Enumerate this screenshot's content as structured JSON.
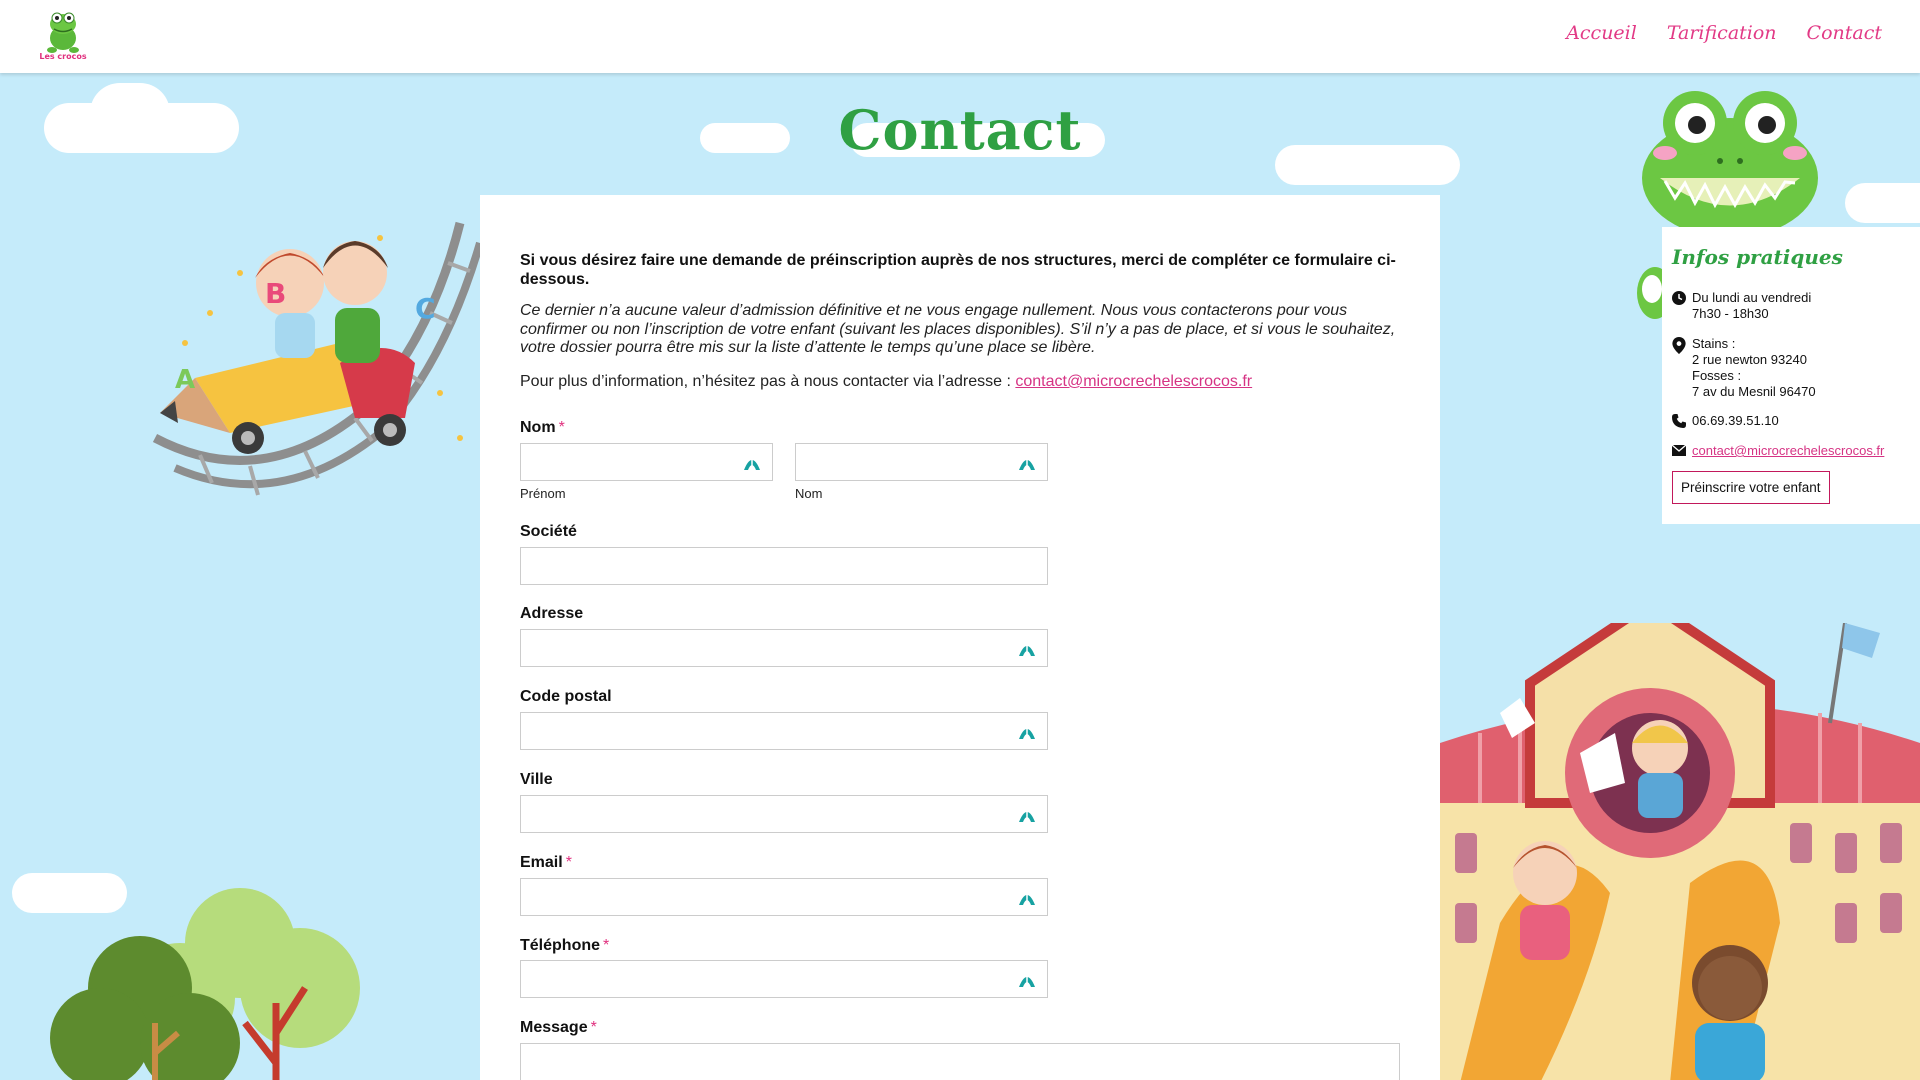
{
  "brand": {
    "logo_text": "Les crocos",
    "colors": {
      "accent_pink": "#e23a86",
      "accent_green": "#2fa043",
      "sky": "#c5ebfa"
    }
  },
  "nav": [
    {
      "label": "Accueil",
      "name": "nav-accueil"
    },
    {
      "label": "Tarification",
      "name": "nav-tarification"
    },
    {
      "label": "Contact",
      "name": "nav-contact"
    }
  ],
  "page": {
    "title": "Contact"
  },
  "intro": {
    "bold": "Si vous désirez faire une demande de préinscription auprès de nos structures, merci de compléter ce formulaire ci-dessous.",
    "italic": "Ce dernier n’a aucune valeur d’admission définitive et ne vous engage nullement. Nous vous contacterons pour vous confirmer ou non l’inscription de votre enfant (suivant les places disponibles). S’il n’y a pas de place, et si vous le souhaitez, votre dossier pourra être mis sur la liste d’attente le temps qu’une place se libère.",
    "contact_prefix": "Pour plus d’information, n’hésitez pas à nous contacter via l’adresse : ",
    "contact_email": "contact@microcrechelescrocos.fr"
  },
  "form": {
    "nom_label": "Nom",
    "required_mark": "*",
    "prenom_sublabel": "Prénom",
    "nom_sublabel": "Nom",
    "societe_label": "Société",
    "adresse_label": "Adresse",
    "code_postal_label": "Code postal",
    "ville_label": "Ville",
    "email_label": "Email",
    "telephone_label": "Téléphone",
    "message_label": "Message",
    "values": {
      "prenom": "",
      "nom": "",
      "societe": "",
      "adresse": "",
      "code_postal": "",
      "ville": "",
      "email": "",
      "telephone": "",
      "message": ""
    }
  },
  "infos": {
    "title": "Infos pratiques",
    "hours_line1": "Du lundi au vendredi",
    "hours_line2": "7h30 - 18h30",
    "addr_line1": "Stains :",
    "addr_line2": "2 rue newton 93240",
    "addr_line3": "Fosses :",
    "addr_line4": "7 av du Mesnil 96470",
    "phone": "06.69.39.51.10",
    "email": "contact@microcrechelescrocos.fr",
    "cta": "Préinscrire votre enfant",
    "icons": [
      "clock-icon",
      "map-pin-icon",
      "phone-icon",
      "envelope-icon"
    ]
  }
}
